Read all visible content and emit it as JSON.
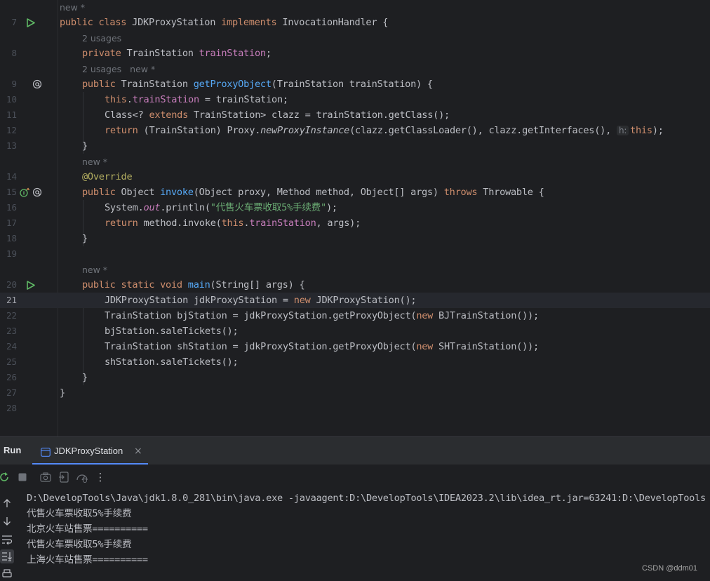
{
  "editor": {
    "current_line": 21,
    "lines": {
      "l7": {
        "number": "7",
        "hint": "new *",
        "t": {
          "a": "public",
          "b": " ",
          "c": "class",
          "d": " JDKProxyStation ",
          "e": "implements",
          "f": " InvocationHandler {"
        }
      },
      "l8": {
        "number": "8",
        "hint": "2 usages",
        "t": {
          "a": "private",
          "b": " TrainStation ",
          "c": "trainStation",
          "d": ";"
        }
      },
      "l9": {
        "number": "9",
        "hint": "2 usages",
        "hint2": "new *",
        "t": {
          "a": "public",
          "b": " TrainStation ",
          "c": "getProxyObject",
          "d": "(TrainStation trainStation) {"
        }
      },
      "l10": {
        "number": "10",
        "t": {
          "a": "this",
          "b": ".",
          "c": "trainStation",
          "d": " = trainStation;"
        }
      },
      "l11": {
        "number": "11",
        "t": {
          "a": "Class<? ",
          "b": "extends",
          "c": " TrainStation> clazz = trainStation.getClass();"
        }
      },
      "l12": {
        "number": "12",
        "t": {
          "a": "return",
          "b": " (TrainStation) Proxy.",
          "c": "newProxyInstance",
          "d": "(clazz.getClassLoader(), clazz.getInterfaces(), ",
          "inlay": "h:",
          "e": "this",
          "f": ");"
        }
      },
      "l13": {
        "number": "13",
        "t": {
          "a": "}"
        }
      },
      "l14": {
        "number": "14",
        "hint": "new *",
        "t": {
          "a": "@Override"
        }
      },
      "l15": {
        "number": "15",
        "t": {
          "a": "public",
          "b": " Object ",
          "c": "invoke",
          "d": "(Object proxy, Method method, Object[] args) ",
          "e": "throws",
          "f": " Throwable {"
        }
      },
      "l16": {
        "number": "16",
        "t": {
          "a": "System.",
          "b": "out",
          "c": ".println(",
          "d": "\"代售火车票收取5%手续费\"",
          "e": ");"
        }
      },
      "l17": {
        "number": "17",
        "t": {
          "a": "return",
          "b": " method.invoke(",
          "c": "this",
          "d": ".",
          "e": "trainStation",
          "f": ", args);"
        }
      },
      "l18": {
        "number": "18",
        "t": {
          "a": "}"
        }
      },
      "l19": {
        "number": "19"
      },
      "l20": {
        "number": "20",
        "hint": "new *",
        "t": {
          "a": "public",
          "b": " ",
          "c": "static",
          "d": " ",
          "e": "void",
          "f": " ",
          "g": "main",
          "h": "(String[] args) {"
        }
      },
      "l21": {
        "number": "21",
        "t": {
          "a": "JDKProxyStation jdkProxyStation = ",
          "b": "new",
          "c": " JDKProxyStation();"
        }
      },
      "l22": {
        "number": "22",
        "t": {
          "a": "TrainStation bjStation = jdkProxyStation.getProxyObject(",
          "b": "new",
          "c": " BJTrainStation());"
        }
      },
      "l23": {
        "number": "23",
        "t": {
          "a": "bjStation.saleTickets();"
        }
      },
      "l24": {
        "number": "24",
        "t": {
          "a": "TrainStation shStation = jdkProxyStation.getProxyObject(",
          "b": "new",
          "c": " SHTrainStation());"
        }
      },
      "l25": {
        "number": "25",
        "t": {
          "a": "shStation.saleTickets();"
        }
      },
      "l26": {
        "number": "26",
        "t": {
          "a": "}"
        }
      },
      "l27": {
        "number": "27",
        "t": {
          "a": "}"
        }
      },
      "l28": {
        "number": "28"
      }
    },
    "gutter_icons": [
      "run-icon",
      "implement-icon",
      "override-icon"
    ]
  },
  "run_panel": {
    "title": "Run",
    "tab_label": "JDKProxyStation",
    "toolbar_icons": [
      "rerun-icon",
      "stop-icon",
      "screenshot-icon",
      "export-icon",
      "coverage-icon",
      "more-icon"
    ],
    "side_icons": [
      "scroll-up-icon",
      "scroll-down-icon",
      "soft-wrap-icon",
      "scroll-to-end-icon",
      "print-icon"
    ],
    "console_lines": [
      "D:\\DevelopTools\\Java\\jdk1.8.0_281\\bin\\java.exe -javaagent:D:\\DevelopTools\\IDEA2023.2\\lib\\idea_rt.jar=63241:D:\\DevelopTools",
      "代售火车票收取5%手续费",
      "北京火车站售票==========",
      "代售火车票收取5%手续费",
      "上海火车站售票=========="
    ]
  },
  "watermark": "CSDN @ddm01",
  "colors": {
    "background": "#1e1f22",
    "keyword": "#cf8e6d",
    "field": "#c77dbb",
    "method": "#56a8f5",
    "string": "#6aab73",
    "annotation": "#b3ae60",
    "run_green": "#5fb865",
    "accent": "#548af7"
  }
}
